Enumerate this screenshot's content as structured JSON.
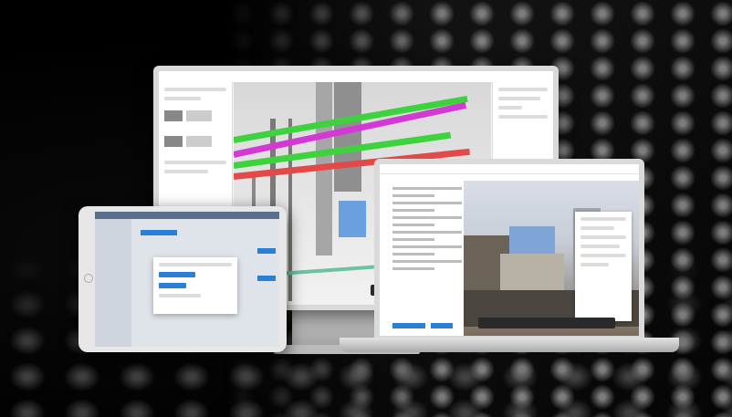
{
  "scene": {
    "description_visible_text": "",
    "devices": [
      "monitor",
      "tablet",
      "laptop"
    ]
  },
  "colors": {
    "pipe_green": "#3fd23f",
    "pipe_magenta": "#d33ad3",
    "pipe_red": "#e24a4a",
    "accent_blue": "#2b7fd6"
  }
}
